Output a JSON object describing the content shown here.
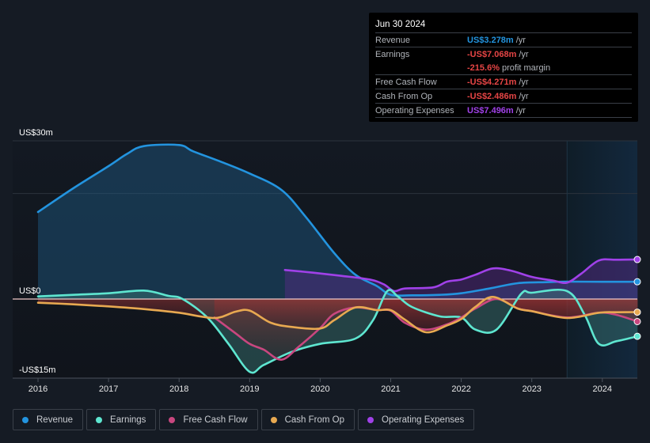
{
  "tooltip": {
    "date": "Jun 30 2024",
    "rows": [
      {
        "label": "Revenue",
        "value": "US$3.278m",
        "unit": "/yr",
        "color": "#2394df"
      },
      {
        "label": "Earnings",
        "value": "-US$7.068m",
        "unit": "/yr",
        "color": "#e64545"
      },
      {
        "label": "",
        "value": "-215.6%",
        "unit": "profit margin",
        "color": "#e64545"
      },
      {
        "label": "Free Cash Flow",
        "value": "-US$4.271m",
        "unit": "/yr",
        "color": "#e64545"
      },
      {
        "label": "Cash From Op",
        "value": "-US$2.486m",
        "unit": "/yr",
        "color": "#e64545"
      },
      {
        "label": "Operating Expenses",
        "value": "US$7.496m",
        "unit": "/yr",
        "color": "#a041e8"
      }
    ]
  },
  "legend": [
    {
      "label": "Revenue",
      "color": "#2394df"
    },
    {
      "label": "Earnings",
      "color": "#5ee6d0"
    },
    {
      "label": "Free Cash Flow",
      "color": "#c8477f"
    },
    {
      "label": "Cash From Op",
      "color": "#e8a951"
    },
    {
      "label": "Operating Expenses",
      "color": "#a041e8"
    }
  ],
  "chart_data": {
    "type": "area",
    "title": "",
    "xlabel": "",
    "ylabel": "",
    "ylim": [
      -15,
      30
    ],
    "xlim": [
      2015.7,
      2024.5
    ],
    "y_ticks": [
      {
        "value": 30,
        "label": "US$30m"
      },
      {
        "value": 0,
        "label": "US$0"
      },
      {
        "value": -15,
        "label": "-US$15m"
      }
    ],
    "x_ticks": [
      {
        "value": 2016,
        "label": "2016"
      },
      {
        "value": 2017,
        "label": "2017"
      },
      {
        "value": 2018,
        "label": "2018"
      },
      {
        "value": 2019,
        "label": "2019"
      },
      {
        "value": 2020,
        "label": "2020"
      },
      {
        "value": 2021,
        "label": "2021"
      },
      {
        "value": 2022,
        "label": "2022"
      },
      {
        "value": 2023,
        "label": "2023"
      },
      {
        "value": 2024,
        "label": "2024"
      }
    ],
    "grid_values": [
      30,
      20
    ],
    "highlight_from": 2023.5,
    "units": "US$m",
    "series": [
      {
        "name": "Revenue",
        "color": "#2394df",
        "fill": "#1e5a86",
        "points": [
          [
            2016.0,
            16.5
          ],
          [
            2016.5,
            21.0
          ],
          [
            2017.0,
            25.2
          ],
          [
            2017.26,
            27.5
          ],
          [
            2017.5,
            29.0
          ],
          [
            2018.0,
            29.2
          ],
          [
            2018.2,
            28.0
          ],
          [
            2018.6,
            26.0
          ],
          [
            2019.0,
            23.8
          ],
          [
            2019.45,
            20.7
          ],
          [
            2019.8,
            15.5
          ],
          [
            2020.2,
            8.7
          ],
          [
            2020.5,
            4.6
          ],
          [
            2020.8,
            2.5
          ],
          [
            2021.0,
            0.8
          ],
          [
            2021.3,
            0.7
          ],
          [
            2021.7,
            0.8
          ],
          [
            2022.0,
            1.1
          ],
          [
            2022.4,
            2.0
          ],
          [
            2022.8,
            3.0
          ],
          [
            2023.2,
            3.2
          ],
          [
            2023.5,
            3.3
          ],
          [
            2024.0,
            3.27
          ],
          [
            2024.5,
            3.278
          ]
        ]
      },
      {
        "name": "Operating Expenses",
        "color": "#a041e8",
        "fill": "#5a2a8a",
        "points": [
          [
            2019.5,
            5.5
          ],
          [
            2019.9,
            5.0
          ],
          [
            2020.3,
            4.4
          ],
          [
            2020.7,
            3.7
          ],
          [
            2020.9,
            2.8
          ],
          [
            2021.05,
            1.5
          ],
          [
            2021.2,
            2.0
          ],
          [
            2021.6,
            2.2
          ],
          [
            2021.8,
            3.3
          ],
          [
            2022.0,
            3.7
          ],
          [
            2022.2,
            4.6
          ],
          [
            2022.45,
            5.8
          ],
          [
            2022.7,
            5.4
          ],
          [
            2023.0,
            4.2
          ],
          [
            2023.3,
            3.5
          ],
          [
            2023.5,
            3.1
          ],
          [
            2023.7,
            4.8
          ],
          [
            2023.95,
            7.3
          ],
          [
            2024.2,
            7.45
          ],
          [
            2024.5,
            7.496
          ]
        ]
      },
      {
        "name": "Earnings",
        "color": "#5ee6d0",
        "fill": "#3c7a78",
        "points": [
          [
            2016.0,
            0.5
          ],
          [
            2016.5,
            0.8
          ],
          [
            2017.0,
            1.1
          ],
          [
            2017.5,
            1.6
          ],
          [
            2017.85,
            0.6
          ],
          [
            2018.05,
            0.0
          ],
          [
            2018.4,
            -3.5
          ],
          [
            2018.7,
            -8.5
          ],
          [
            2019.0,
            -13.8
          ],
          [
            2019.2,
            -12.5
          ],
          [
            2019.6,
            -10.0
          ],
          [
            2020.0,
            -8.5
          ],
          [
            2020.5,
            -7.5
          ],
          [
            2020.75,
            -4.0
          ],
          [
            2020.95,
            1.5
          ],
          [
            2021.1,
            0.5
          ],
          [
            2021.3,
            -1.5
          ],
          [
            2021.7,
            -3.3
          ],
          [
            2022.0,
            -3.5
          ],
          [
            2022.2,
            -5.8
          ],
          [
            2022.5,
            -5.8
          ],
          [
            2022.85,
            1.0
          ],
          [
            2023.0,
            1.2
          ],
          [
            2023.5,
            1.5
          ],
          [
            2023.75,
            -3.0
          ],
          [
            2023.95,
            -8.5
          ],
          [
            2024.2,
            -8.0
          ],
          [
            2024.5,
            -7.068
          ]
        ]
      },
      {
        "name": "Free Cash Flow",
        "color": "#c8477f",
        "fill": "#8a2f3a",
        "points": [
          [
            2018.5,
            -3.5
          ],
          [
            2018.8,
            -6.5
          ],
          [
            2019.0,
            -8.5
          ],
          [
            2019.2,
            -9.6
          ],
          [
            2019.45,
            -11.5
          ],
          [
            2019.7,
            -9.0
          ],
          [
            2020.0,
            -5.5
          ],
          [
            2020.2,
            -2.8
          ],
          [
            2020.5,
            -1.6
          ],
          [
            2020.8,
            -2.1
          ],
          [
            2021.0,
            -2.2
          ],
          [
            2021.2,
            -4.5
          ],
          [
            2021.5,
            -5.8
          ],
          [
            2021.8,
            -4.8
          ],
          [
            2022.0,
            -3.5
          ],
          [
            2022.2,
            -1.8
          ],
          [
            2022.5,
            0.0
          ],
          [
            2022.8,
            -1.8
          ],
          [
            2023.0,
            -2.3
          ],
          [
            2023.5,
            -3.5
          ],
          [
            2023.95,
            -2.6
          ],
          [
            2024.2,
            -3.0
          ],
          [
            2024.5,
            -4.271
          ]
        ]
      },
      {
        "name": "Cash From Op",
        "color": "#e8a951",
        "fill": "#7a2a2a",
        "points": [
          [
            2016.0,
            -0.7
          ],
          [
            2016.5,
            -1.0
          ],
          [
            2017.0,
            -1.4
          ],
          [
            2017.5,
            -1.9
          ],
          [
            2018.0,
            -2.6
          ],
          [
            2018.5,
            -3.6
          ],
          [
            2018.8,
            -2.4
          ],
          [
            2019.0,
            -2.2
          ],
          [
            2019.3,
            -4.5
          ],
          [
            2019.6,
            -5.3
          ],
          [
            2020.0,
            -5.6
          ],
          [
            2020.2,
            -4.0
          ],
          [
            2020.5,
            -1.6
          ],
          [
            2020.8,
            -2.1
          ],
          [
            2021.0,
            -2.1
          ],
          [
            2021.2,
            -3.9
          ],
          [
            2021.5,
            -6.3
          ],
          [
            2021.8,
            -5.0
          ],
          [
            2022.0,
            -3.8
          ],
          [
            2022.2,
            -1.5
          ],
          [
            2022.45,
            0.4
          ],
          [
            2022.8,
            -1.8
          ],
          [
            2023.0,
            -2.3
          ],
          [
            2023.5,
            -3.6
          ],
          [
            2023.95,
            -2.6
          ],
          [
            2024.2,
            -2.5
          ],
          [
            2024.5,
            -2.486
          ]
        ]
      }
    ]
  }
}
